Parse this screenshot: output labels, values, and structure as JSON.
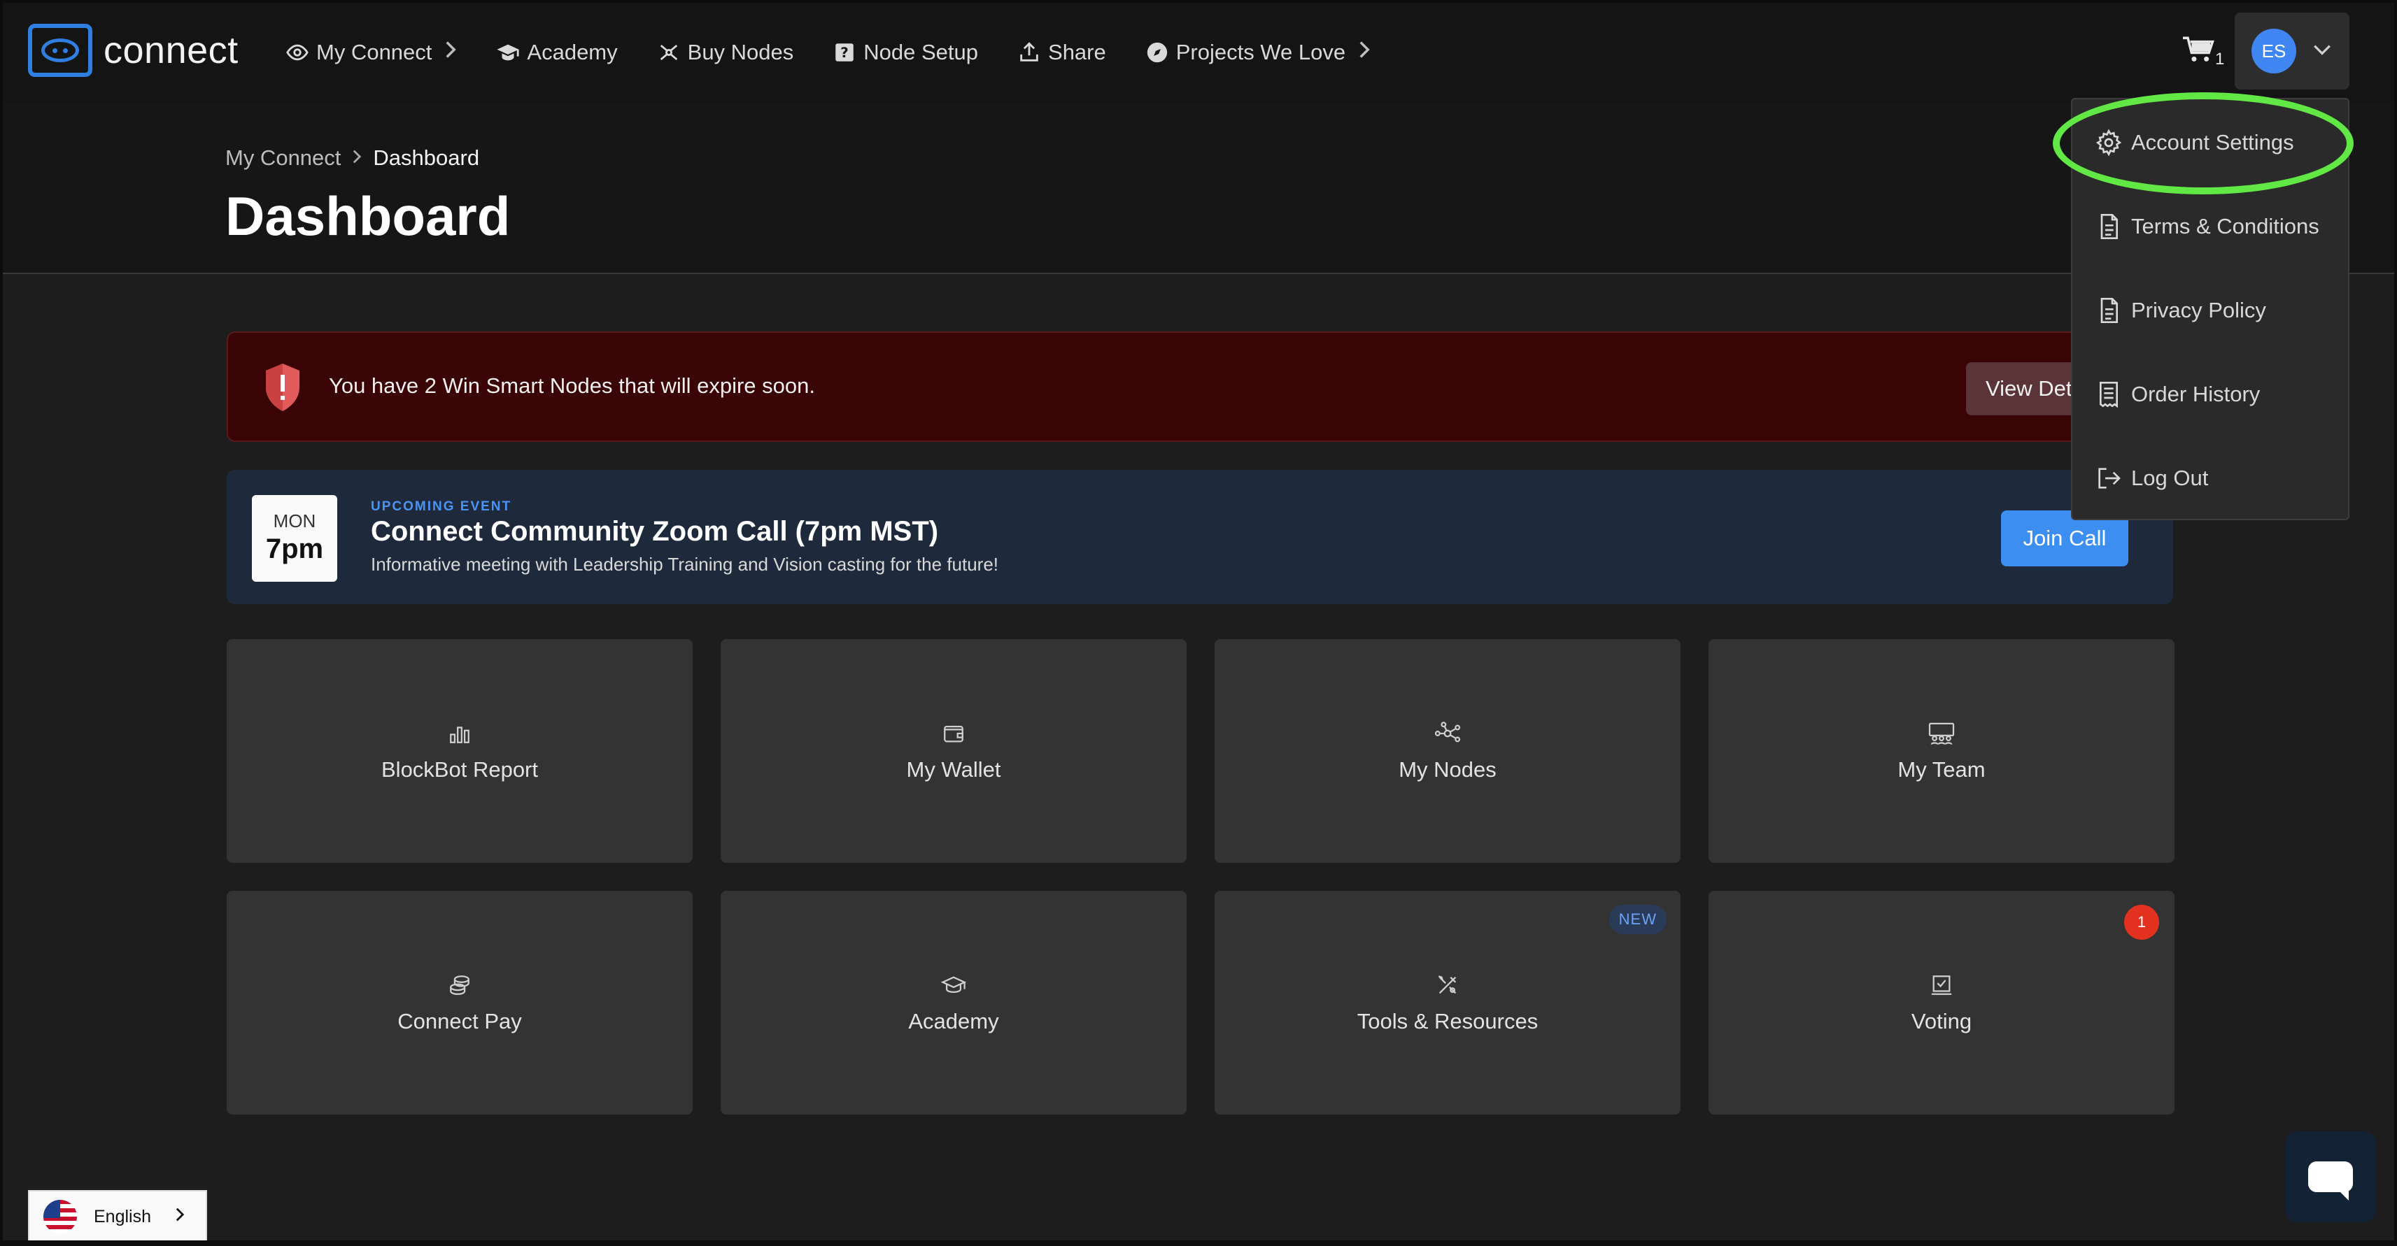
{
  "brand": {
    "name": "connect"
  },
  "nav": {
    "items": [
      {
        "label": "My Connect",
        "icon": "eye-icon",
        "has_chevron": true
      },
      {
        "label": "Academy",
        "icon": "graduation-cap-icon",
        "has_chevron": false
      },
      {
        "label": "Buy Nodes",
        "icon": "nodes-icon",
        "has_chevron": false
      },
      {
        "label": "Node Setup",
        "icon": "help-book-icon",
        "has_chevron": false
      },
      {
        "label": "Share",
        "icon": "share-upload-icon",
        "has_chevron": false
      },
      {
        "label": "Projects We Love",
        "icon": "compass-icon",
        "has_chevron": true
      }
    ],
    "cart_count": "1",
    "user_initials": "ES"
  },
  "header": {
    "breadcrumb": [
      "My Connect",
      "Dashboard"
    ],
    "title": "Dashboard"
  },
  "alert": {
    "text": "You have 2 Win Smart Nodes that will expire soon.",
    "button": "View Details"
  },
  "event": {
    "day": "MON",
    "time": "7pm",
    "kicker": "UPCOMING EVENT",
    "title": "Connect Community Zoom Call (7pm MST)",
    "description": "Informative meeting with Leadership Training and Vision casting for the future!",
    "button": "Join Call"
  },
  "cards": [
    {
      "label": "BlockBot Report",
      "icon": "bar-chart-icon"
    },
    {
      "label": "My Wallet",
      "icon": "wallet-icon"
    },
    {
      "label": "My Nodes",
      "icon": "network-nodes-icon"
    },
    {
      "label": "My Team",
      "icon": "team-icon"
    },
    {
      "label": "Connect Pay",
      "icon": "coins-stack-icon"
    },
    {
      "label": "Academy",
      "icon": "graduation-cap-icon"
    },
    {
      "label": "Tools & Resources",
      "icon": "tools-icon",
      "badge": "NEW"
    },
    {
      "label": "Voting",
      "icon": "ballot-check-icon",
      "count": "1"
    }
  ],
  "account_menu": {
    "items": [
      {
        "label": "Account Settings",
        "icon": "gear-icon"
      },
      {
        "label": "Terms & Conditions",
        "icon": "document-icon"
      },
      {
        "label": "Privacy Policy",
        "icon": "document-icon"
      },
      {
        "label": "Order History",
        "icon": "receipt-icon"
      },
      {
        "label": "Log Out",
        "icon": "logout-icon"
      }
    ]
  },
  "language": {
    "label": "English"
  },
  "colors": {
    "accent": "#3c8ef0",
    "alert_bg": "#3a0305",
    "event_bg": "#1e2a3c",
    "highlight": "#62e845",
    "badge_red": "#e3311f"
  }
}
